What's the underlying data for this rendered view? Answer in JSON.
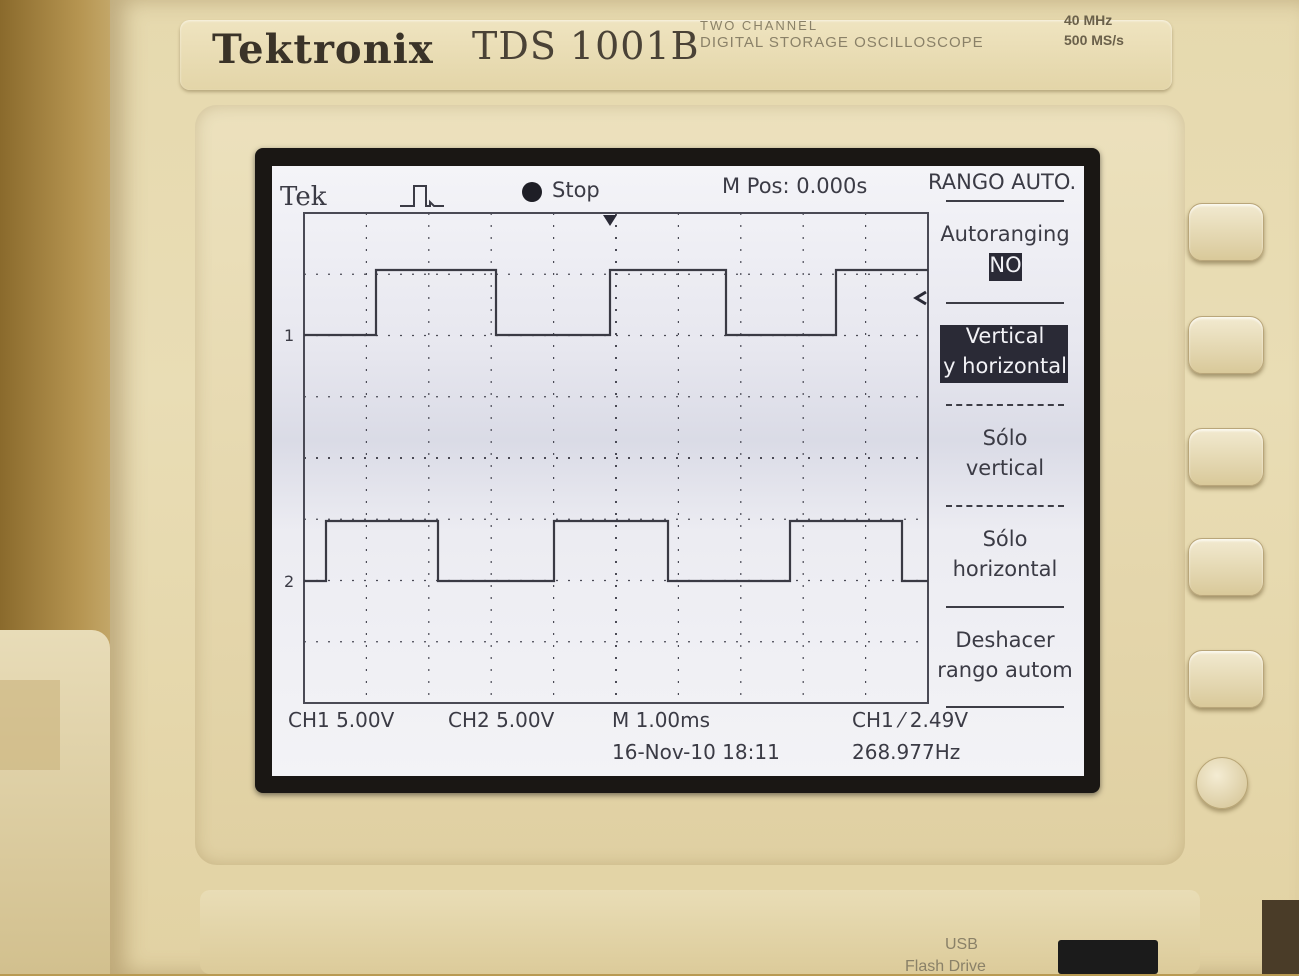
{
  "instrument": {
    "brand": "Tektronix",
    "model": "TDS 1001B",
    "description_line1": "TWO CHANNEL",
    "description_line2": "DIGITAL STORAGE OSCILLOSCOPE",
    "spec_bandwidth": "40 MHz",
    "spec_sample_rate": "500 MS/s",
    "usb_label_1": "USB",
    "usb_label_2": "Flash Drive"
  },
  "screen": {
    "top_bar": {
      "logo": "Tek",
      "run_state": "Stop",
      "position": "M Pos: 0.000s"
    },
    "menu": {
      "title": "RANGO AUTO.",
      "items": [
        {
          "line1": "Autoranging",
          "line2": "NO",
          "selected": false
        },
        {
          "line1": "Vertical",
          "line2": "y horizontal",
          "selected": true
        },
        {
          "line1": "Sólo",
          "line2": "vertical",
          "selected": false
        },
        {
          "line1": "Sólo",
          "line2": "horizontal",
          "selected": false
        },
        {
          "line1": "Deshacer",
          "line2": "rango autom",
          "selected": false
        }
      ]
    },
    "status_bar": {
      "ch1_scale": "CH1  5.00V",
      "ch2_scale": "CH2  5.00V",
      "timebase": "M 1.00ms",
      "trigger": "CH1 ⁄ 2.49V",
      "date_time": "16-Nov-10 18:11",
      "frequency": "268.977Hz"
    },
    "channel_markers": {
      "ch1": "1",
      "ch2": "2"
    }
  },
  "colors": {
    "screen_bg": "#eeeef3",
    "trace": "#3a3a44",
    "grid": "#4a4a55",
    "menu_highlight": "#2a2a36",
    "housing": "#e6d9ae"
  }
}
